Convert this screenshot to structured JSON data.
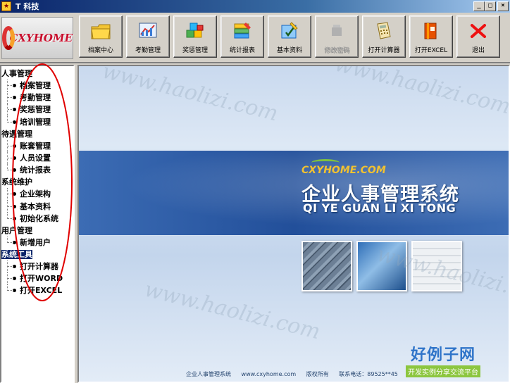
{
  "window": {
    "title": "T 科技",
    "controls": {
      "minimize": "_",
      "maximize": "□",
      "close": "×"
    }
  },
  "logo": {
    "text": "CXYHOME"
  },
  "toolbar": {
    "buttons": [
      {
        "label": "档案中心",
        "icon": "folder-icon",
        "enabled": true
      },
      {
        "label": "考勤管理",
        "icon": "chart-icon",
        "enabled": true
      },
      {
        "label": "奖惩管理",
        "icon": "blocks-icon",
        "enabled": true
      },
      {
        "label": "统计报表",
        "icon": "report-icon",
        "enabled": true
      },
      {
        "label": "基本资料",
        "icon": "edit-icon",
        "enabled": true
      },
      {
        "label": "修改密码",
        "icon": "password-icon",
        "enabled": false
      },
      {
        "label": "打开计算器",
        "icon": "calculator-icon",
        "enabled": true
      },
      {
        "label": "打开EXCEL",
        "icon": "excel-book-icon",
        "enabled": true
      },
      {
        "label": "退出",
        "icon": "exit-x-icon",
        "enabled": true
      }
    ]
  },
  "sidebar": {
    "groups": [
      {
        "label": "人事管理",
        "items": [
          "档案管理",
          "考勤管理",
          "奖惩管理",
          "培训管理"
        ]
      },
      {
        "label": "待遇管理",
        "items": [
          "账套管理",
          "人员设置",
          "统计报表"
        ]
      },
      {
        "label": "系统维护",
        "items": [
          "企业架构",
          "基本资料",
          "初始化系统"
        ]
      },
      {
        "label": "用户管理",
        "items": [
          "新增用户"
        ]
      },
      {
        "label": "系统工具",
        "items": [
          "打开计算器",
          "打开WORD",
          "打开EXCEL"
        ],
        "selected": true
      }
    ]
  },
  "banner": {
    "brand": "CXYHOME.COM",
    "headline": "企业人事管理系统",
    "subline": "QI YE GUAN LI XI TONG"
  },
  "footer": {
    "system_name": "企业人事管理系统",
    "website": "www.cxyhome.com",
    "copyright": "版权所有",
    "phone": "联系电话：89525**45",
    "extra": "89"
  },
  "watermark": {
    "site_text": "www.haolizi.com",
    "logo_main": "好例子网",
    "logo_sub": "开发实例分享交流平台"
  },
  "colors": {
    "titlebar": "#0a246a",
    "selection": "#0a246a",
    "banner": "#224f9a",
    "annotation": "#e00000"
  }
}
